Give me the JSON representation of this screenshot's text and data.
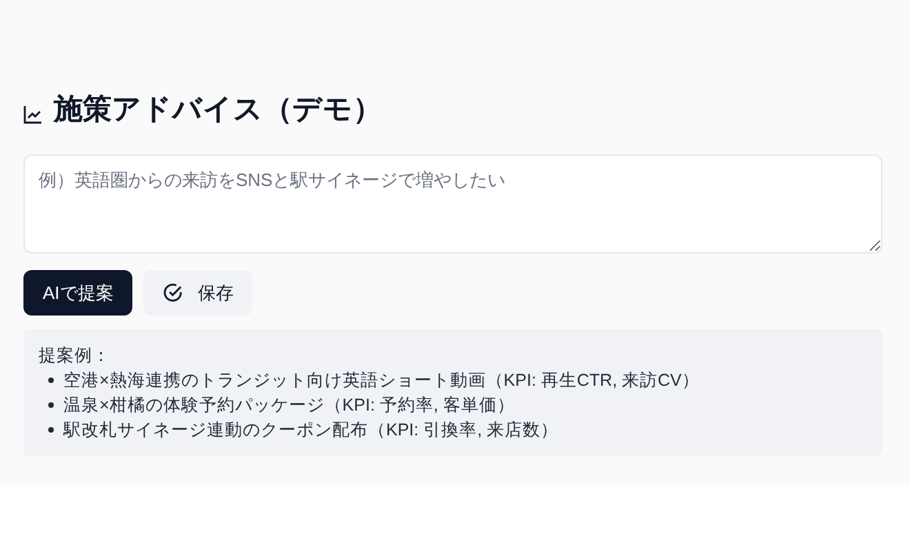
{
  "title": "施策アドバイス（デモ）",
  "prompt": {
    "placeholder": "例）英語圏からの来訪をSNSと駅サイネージで増やしたい"
  },
  "buttons": [
    {
      "label": "AIで提案",
      "kind": "primary"
    },
    {
      "label": "保存",
      "kind": "secondary"
    }
  ],
  "examples": {
    "heading": "提案例：",
    "items": [
      "空港×熱海連携のトランジット向け英語ショート動画（KPI: 再生CTR, 来訪CV）",
      "温泉×柑橘の体験予約パッケージ（KPI: 予約率, 客単価）",
      "駅改札サイネージ連動のクーポン配布（KPI: 引換率, 来店数）"
    ]
  }
}
